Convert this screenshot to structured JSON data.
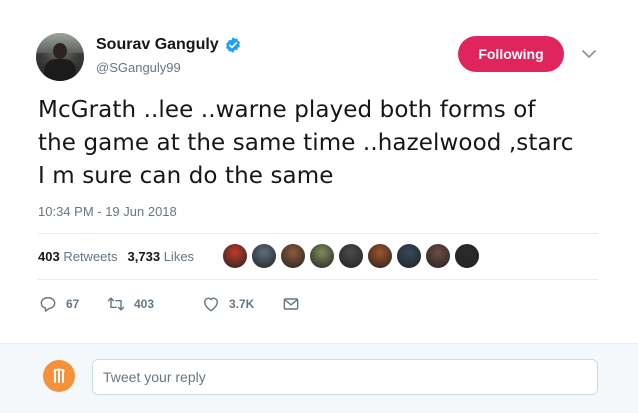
{
  "author": {
    "display_name": "Sourav Ganguly",
    "handle": "@SGanguly99",
    "verified": true,
    "avatar_icon": "profile-photo"
  },
  "follow_button": {
    "label": "Following",
    "color": "#e0245e"
  },
  "menu_icon": "chevron-down-icon",
  "tweet": {
    "text_lines": [
      "McGrath ..lee ..warne played both forms of",
      "the game at the same time ..hazelwood ,starc",
      "I m sure can do the same"
    ],
    "timestamp": "10:34 PM - 19 Jun 2018"
  },
  "stats": {
    "retweets_count": "403",
    "retweets_label": "Retweets",
    "likes_count": "3,733",
    "likes_label": "Likes",
    "liker_avatar_colors": [
      "#c0392b",
      "#5d6d7e",
      "#8e5a3c",
      "#7f8c5d",
      "#4a4a4a",
      "#a0522d",
      "#34495e",
      "#6d4c41",
      "#2c2c2c"
    ]
  },
  "actions": {
    "reply_count": "67",
    "retweet_count": "403",
    "like_count": "3.7K",
    "icons": [
      "reply-icon",
      "retweet-icon",
      "heart-icon",
      "message-icon"
    ]
  },
  "reply_box": {
    "placeholder": "Tweet your reply",
    "avatar_color": "#f5913a"
  },
  "colors": {
    "text_primary": "#14171a",
    "text_secondary": "#657786",
    "divider": "#e6ecf0",
    "verified_blue": "#1da1f2"
  }
}
